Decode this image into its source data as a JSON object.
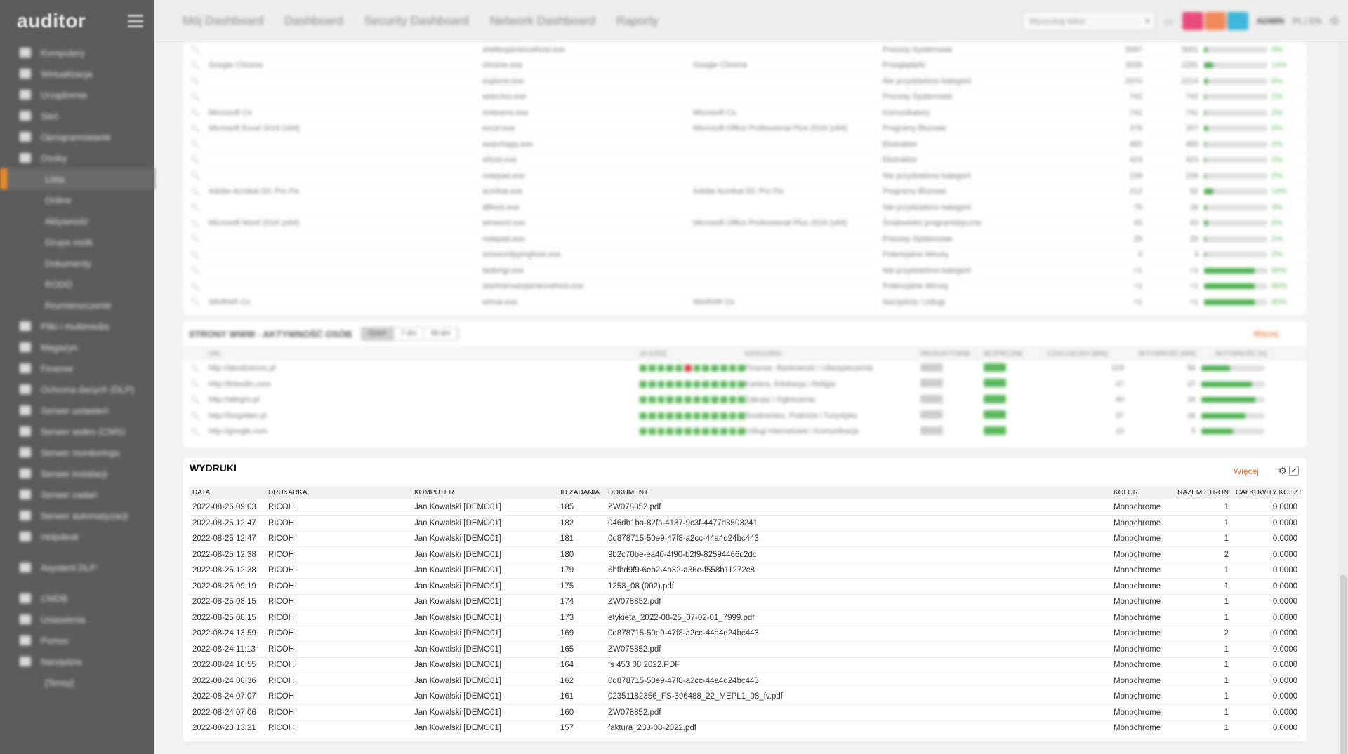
{
  "app": {
    "logo": "auditor"
  },
  "sidebar": {
    "items": [
      {
        "label": "Komputery",
        "type": "main"
      },
      {
        "label": "Wirtualizacja",
        "type": "main"
      },
      {
        "label": "Urządzenia",
        "type": "main"
      },
      {
        "label": "Sieć",
        "type": "main"
      },
      {
        "label": "Oprogramowanie",
        "type": "main"
      },
      {
        "label": "Osoby",
        "type": "main"
      },
      {
        "label": "Lista",
        "type": "sub",
        "active": true
      },
      {
        "label": "Online",
        "type": "sub"
      },
      {
        "label": "Aktywność",
        "type": "sub"
      },
      {
        "label": "Grupa osób",
        "type": "sub"
      },
      {
        "label": "Dokumenty",
        "type": "sub"
      },
      {
        "label": "RODO",
        "type": "sub"
      },
      {
        "label": "Rozmieszczenie",
        "type": "sub"
      },
      {
        "label": "Pliki i multimedia",
        "type": "main"
      },
      {
        "label": "Magazyn",
        "type": "main"
      },
      {
        "label": "Finanse",
        "type": "main"
      },
      {
        "label": "Ochrona danych (DLP)",
        "type": "main"
      },
      {
        "label": "Serwer ustawień",
        "type": "main"
      },
      {
        "label": "Serwer wideo (CMS)",
        "type": "main"
      },
      {
        "label": "Serwer monitoringu",
        "type": "main"
      },
      {
        "label": "Serwer instalacji",
        "type": "main"
      },
      {
        "label": "Serwer zadań",
        "type": "main"
      },
      {
        "label": "Serwer automatyzacji",
        "type": "main"
      },
      {
        "label": "Helpdesk",
        "type": "main"
      },
      {
        "label": "Asystent DLP",
        "type": "main",
        "gap": true
      },
      {
        "label": "CMDB",
        "type": "main",
        "gap": true
      },
      {
        "label": "Ustawienia",
        "type": "main"
      },
      {
        "label": "Pomoc",
        "type": "main"
      },
      {
        "label": "Narzędzia",
        "type": "main"
      },
      {
        "label": "[Tensy]",
        "type": "sub"
      }
    ]
  },
  "topbar": {
    "tabs": [
      "Mój Dashboard",
      "Dashboard",
      "Security Dashboard",
      "Network Dashboard",
      "Raporty"
    ],
    "search_placeholder": "Wyszukaj tekst",
    "user": "ADMIN",
    "lang": "PL | EN",
    "colors": {
      "pink": "#e94b7d",
      "orange": "#f08a5a",
      "blue": "#3fb6dc",
      "accent": "#e06b1f"
    }
  },
  "apps_panel": {
    "rows": [
      {
        "name": "",
        "exe": "shellexperiencehost.exe",
        "product": "",
        "category": "Procesy Systemowe",
        "a": "3097",
        "b": "3001",
        "pct": 4
      },
      {
        "name": "Google Chrome",
        "exe": "chrome.exe",
        "product": "Google Chrome",
        "category": "Przeglądarki",
        "a": "3039",
        "b": "2291",
        "pct": 14
      },
      {
        "name": "",
        "exe": "explorer.exe",
        "product": "",
        "category": "Nie przydzielono kategorii",
        "a": "2970",
        "b": "2214",
        "pct": 6
      },
      {
        "name": "",
        "exe": "searchui.exe",
        "product": "",
        "category": "Procesy Systemowe",
        "a": "742",
        "b": "742",
        "pct": 2
      },
      {
        "name": "Microsoft Co",
        "exe": "msteams.exe",
        "product": "Microsoft Co",
        "category": "Komunikatory",
        "a": "741",
        "b": "741",
        "pct": 2
      },
      {
        "name": "Microsoft Excel 2016 (x64)",
        "exe": "excel.exe",
        "product": "Microsoft Office Professional Plus 2016 (x64)",
        "category": "Programy Biurowe",
        "a": "378",
        "b": "357",
        "pct": 6
      },
      {
        "name": "",
        "exe": "searchapp.exe",
        "product": "",
        "category": "Ekstraktor",
        "a": "483",
        "b": "483",
        "pct": 2
      },
      {
        "name": "",
        "exe": "sihost.exe",
        "product": "",
        "category": "Ekstraktor",
        "a": "423",
        "b": "423",
        "pct": 2
      },
      {
        "name": "",
        "exe": "notepad.exe",
        "product": "",
        "category": "Nie przydzielono kategorii",
        "a": "239",
        "b": "239",
        "pct": 2
      },
      {
        "name": "Adobe Acrobat DC Pro Fix",
        "exe": "acrobat.exe",
        "product": "Adobe Acrobat DC Pro Fix",
        "category": "Programy Biurowe",
        "a": "212",
        "b": "92",
        "pct": 14
      },
      {
        "name": "",
        "exe": "dllhost.exe",
        "product": "",
        "category": "Nie przydzielono kategorii",
        "a": "75",
        "b": "28",
        "pct": 3
      },
      {
        "name": "Microsoft Word 2016 (x64)",
        "exe": "winword.exe",
        "product": "Microsoft Office Professional Plus 2016 (x64)",
        "category": "Środowisko programistyczne",
        "a": "43",
        "b": "43",
        "pct": 6
      },
      {
        "name": "",
        "exe": "notepad.exe",
        "product": "",
        "category": "Procesy Systemowe",
        "a": "29",
        "b": "29",
        "pct": 2
      },
      {
        "name": "",
        "exe": "screenclippinghost.exe",
        "product": "",
        "category": "Potencjalne Wirusy",
        "a": "3",
        "b": "3",
        "pct": 2
      },
      {
        "name": "",
        "exe": "taskmgr.exe",
        "product": "",
        "category": "Nie przydzielono kategorii",
        "a": "<1",
        "b": "<1",
        "pct": 80
      },
      {
        "name": "",
        "exe": "startmenuexperiencehost.exe",
        "product": "",
        "category": "Potencjalne Wirusy",
        "a": "<1",
        "b": "<1",
        "pct": 80
      },
      {
        "name": "WinRAR Co",
        "exe": "winrar.exe",
        "product": "WinRAR Co",
        "category": "Narzędzia i Usługi",
        "a": "<1",
        "b": "<1",
        "pct": 80
      }
    ]
  },
  "www_panel": {
    "title": "STRONY WWW - AKTYWNOŚĆ OSÓB",
    "ranges": [
      "Dzień",
      "7 dni",
      "30 dni"
    ],
    "more": "Więcej",
    "headers": [
      "URL",
      "24 GODZ",
      "KATEGORIA",
      "PRODUKTYWNE",
      "BEZPIECZNE",
      "CZAS ŁĄCZNY [MIN]",
      "AKTYWNOŚĆ [MIN]",
      "AKTYWNOŚĆ [%]"
    ],
    "rows": [
      {
        "url": "http://akodzienne.pl",
        "category": "Finanse, Bankowość i Ubezpieczenia",
        "a": "103",
        "b": "56",
        "pct": 45,
        "red": 5
      },
      {
        "url": "http://linkedin.com",
        "category": "Kariera, Edukacja i Religia",
        "a": "47",
        "b": "37",
        "pct": 80,
        "red": -1
      },
      {
        "url": "http://allegro.pl",
        "category": "Zakupy i Ogłoszenia",
        "a": "40",
        "b": "34",
        "pct": 85,
        "red": -1
      },
      {
        "url": "http://forgotten.pl",
        "category": "Środowisko, Podróże i Turystyka",
        "a": "37",
        "b": "26",
        "pct": 70,
        "red": -1
      },
      {
        "url": "http://google.com",
        "category": "Usługi internetowe i Komunikacja",
        "a": "10",
        "b": "5",
        "pct": 50,
        "red": -1
      }
    ]
  },
  "wydruki": {
    "title": "WYDRUKI",
    "more": "Więcej",
    "headers": {
      "data": "DATA",
      "drukarka": "DRUKARKA",
      "komputer": "KOMPUTER",
      "id": "ID ZADANIA",
      "dokument": "DOKUMENT",
      "kolor": "KOLOR",
      "strony": "RAZEM STRON",
      "koszt": "CAŁKOWITY KOSZT"
    },
    "rows": [
      {
        "data": "2022-08-26 09:03",
        "drukarka": "RICOH",
        "komputer": "Jan Kowalski [DEMO01]",
        "id": "185",
        "dokument": "ZW078852.pdf",
        "kolor": "Monochrome",
        "strony": "1",
        "koszt": "0.0000"
      },
      {
        "data": "2022-08-25 12:47",
        "drukarka": "RICOH",
        "komputer": "Jan Kowalski [DEMO01]",
        "id": "182",
        "dokument": "046db1ba-82fa-4137-9c3f-4477d8503241",
        "kolor": "Monochrome",
        "strony": "1",
        "koszt": "0.0000"
      },
      {
        "data": "2022-08-25 12:47",
        "drukarka": "RICOH",
        "komputer": "Jan Kowalski [DEMO01]",
        "id": "181",
        "dokument": "0d878715-50e9-47f8-a2cc-44a4d24bc443",
        "kolor": "Monochrome",
        "strony": "1",
        "koszt": "0.0000"
      },
      {
        "data": "2022-08-25 12:38",
        "drukarka": "RICOH",
        "komputer": "Jan Kowalski [DEMO01]",
        "id": "180",
        "dokument": "9b2c70be-ea40-4f90-b2f9-82594466c2dc",
        "kolor": "Monochrome",
        "strony": "2",
        "koszt": "0.0000"
      },
      {
        "data": "2022-08-25 12:38",
        "drukarka": "RICOH",
        "komputer": "Jan Kowalski [DEMO01]",
        "id": "179",
        "dokument": "6bfbd9f9-6eb2-4a32-a36e-f558b11272c8",
        "kolor": "Monochrome",
        "strony": "1",
        "koszt": "0.0000"
      },
      {
        "data": "2022-08-25 09:19",
        "drukarka": "RICOH",
        "komputer": "Jan Kowalski [DEMO01]",
        "id": "175",
        "dokument": "1258_08 (002).pdf",
        "kolor": "Monochrome",
        "strony": "1",
        "koszt": "0.0000"
      },
      {
        "data": "2022-08-25 08:15",
        "drukarka": "RICOH",
        "komputer": "Jan Kowalski [DEMO01]",
        "id": "174",
        "dokument": "ZW078852.pdf",
        "kolor": "Monochrome",
        "strony": "1",
        "koszt": "0.0000"
      },
      {
        "data": "2022-08-25 08:15",
        "drukarka": "RICOH",
        "komputer": "Jan Kowalski [DEMO01]",
        "id": "173",
        "dokument": "etykieta_2022-08-25_07-02-01_7999.pdf",
        "kolor": "Monochrome",
        "strony": "1",
        "koszt": "0.0000"
      },
      {
        "data": "2022-08-24 13:59",
        "drukarka": "RICOH",
        "komputer": "Jan Kowalski [DEMO01]",
        "id": "169",
        "dokument": "0d878715-50e9-47f8-a2cc-44a4d24bc443",
        "kolor": "Monochrome",
        "strony": "2",
        "koszt": "0.0000"
      },
      {
        "data": "2022-08-24 11:13",
        "drukarka": "RICOH",
        "komputer": "Jan Kowalski [DEMO01]",
        "id": "165",
        "dokument": "ZW078852.pdf",
        "kolor": "Monochrome",
        "strony": "1",
        "koszt": "0.0000"
      },
      {
        "data": "2022-08-24 10:55",
        "drukarka": "RICOH",
        "komputer": "Jan Kowalski [DEMO01]",
        "id": "164",
        "dokument": "fs 453 08 2022.PDF",
        "kolor": "Monochrome",
        "strony": "1",
        "koszt": "0.0000"
      },
      {
        "data": "2022-08-24 08:36",
        "drukarka": "RICOH",
        "komputer": "Jan Kowalski [DEMO01]",
        "id": "162",
        "dokument": "0d878715-50e9-47f8-a2cc-44a4d24bc443",
        "kolor": "Monochrome",
        "strony": "1",
        "koszt": "0.0000"
      },
      {
        "data": "2022-08-24 07:07",
        "drukarka": "RICOH",
        "komputer": "Jan Kowalski [DEMO01]",
        "id": "161",
        "dokument": "02351182356_FS-396488_22_MEPL1_08_fv.pdf",
        "kolor": "Monochrome",
        "strony": "1",
        "koszt": "0.0000"
      },
      {
        "data": "2022-08-24 07:06",
        "drukarka": "RICOH",
        "komputer": "Jan Kowalski [DEMO01]",
        "id": "160",
        "dokument": "ZW078852.pdf",
        "kolor": "Monochrome",
        "strony": "1",
        "koszt": "0.0000"
      },
      {
        "data": "2022-08-23 13:21",
        "drukarka": "RICOH",
        "komputer": "Jan Kowalski [DEMO01]",
        "id": "157",
        "dokument": "faktura_233-08-2022.pdf",
        "kolor": "Monochrome",
        "strony": "1",
        "koszt": "0.0000"
      }
    ]
  }
}
